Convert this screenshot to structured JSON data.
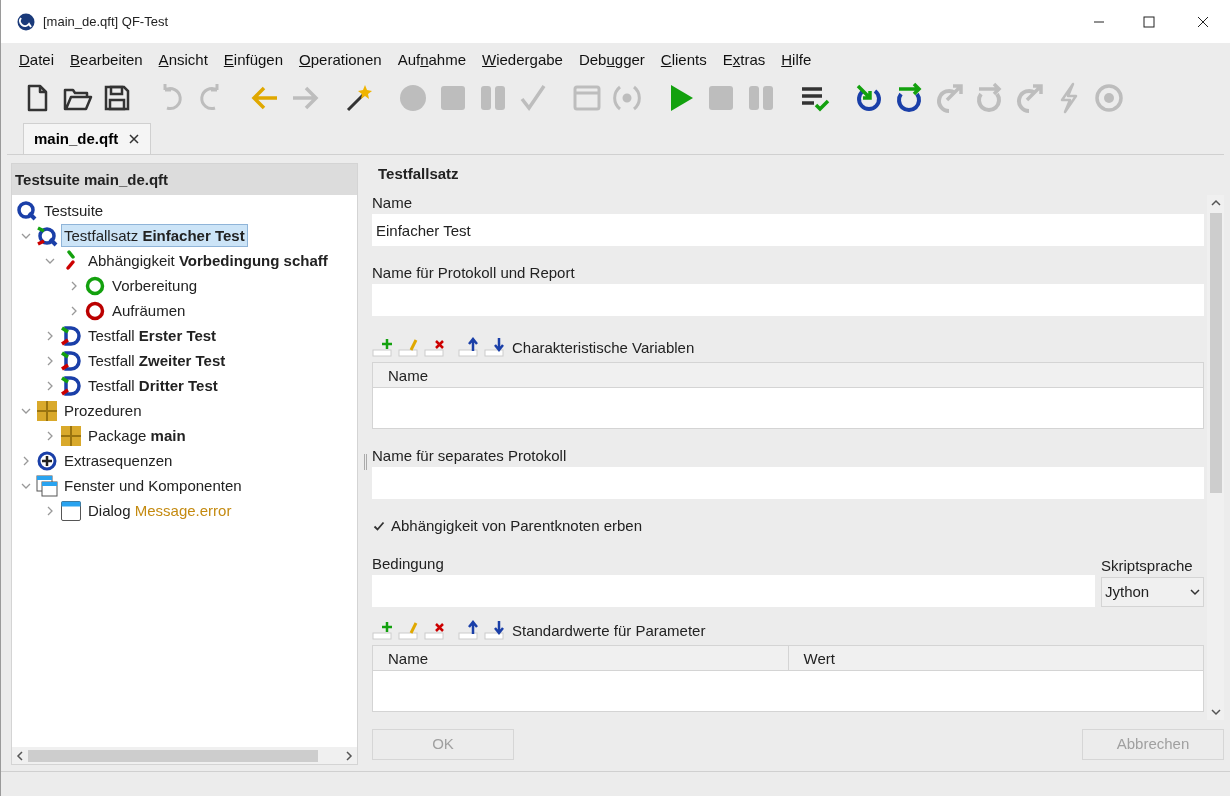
{
  "window": {
    "title": "[main_de.qft] QF-Test"
  },
  "menu": [
    {
      "key": "D",
      "post": "atei"
    },
    {
      "key": "B",
      "post": "earbeiten"
    },
    {
      "key": "A",
      "post": "nsicht"
    },
    {
      "key": "E",
      "post": "infügen"
    },
    {
      "key": "O",
      "post": "perationen"
    },
    {
      "pre": "Auf",
      "key": "n",
      "post": "ahme"
    },
    {
      "key": "W",
      "post": "iedergabe"
    },
    {
      "pre": "Deb",
      "key": "u",
      "post": "gger"
    },
    {
      "key": "C",
      "post": "lients"
    },
    {
      "pre": "E",
      "key": "x",
      "post": "tras"
    },
    {
      "key": "H",
      "post": "ilfe"
    }
  ],
  "toolbar": [
    [
      {
        "kind": "new",
        "disabled": false
      },
      {
        "kind": "open",
        "disabled": false
      },
      {
        "kind": "save",
        "disabled": false
      }
    ],
    [
      {
        "kind": "undo",
        "disabled": true
      },
      {
        "kind": "redo",
        "disabled": true
      }
    ],
    [
      {
        "kind": "back",
        "disabled": false
      },
      {
        "kind": "forward",
        "disabled": true
      }
    ],
    [
      {
        "kind": "wand",
        "disabled": false
      }
    ],
    [
      {
        "kind": "record",
        "disabled": true
      },
      {
        "kind": "stop",
        "disabled": true
      },
      {
        "kind": "pause",
        "disabled": true
      },
      {
        "kind": "check",
        "disabled": true
      }
    ],
    [
      {
        "kind": "window",
        "disabled": true
      },
      {
        "kind": "signal",
        "disabled": true
      }
    ],
    [
      {
        "kind": "play",
        "disabled": false
      },
      {
        "kind": "stop",
        "disabled": true
      },
      {
        "kind": "pause",
        "disabled": true
      }
    ],
    [
      {
        "kind": "list-check",
        "disabled": false
      }
    ],
    [
      {
        "kind": "step-in",
        "disabled": false
      },
      {
        "kind": "step-over",
        "disabled": false
      },
      {
        "kind": "step-out",
        "disabled": true
      },
      {
        "kind": "step-over",
        "disabled": true
      },
      {
        "kind": "step-out",
        "disabled": true
      },
      {
        "kind": "lightning",
        "disabled": true
      },
      {
        "kind": "target",
        "disabled": true
      }
    ]
  ],
  "tabs": [
    {
      "label": "main_de.qft",
      "selected": true
    }
  ],
  "tree": {
    "title": "Testsuite main_de.qft",
    "root": {
      "kind": "suite",
      "label": "Testsuite",
      "selected": false,
      "children": [
        {
          "kind": "testset",
          "label": "Testfallsatz **Einfacher Test**",
          "selected": true,
          "expanded": true,
          "children": [
            {
              "kind": "dependency",
              "label": "Abhängigkeit **Vorbedingung schaff**",
              "selected": false,
              "expanded": true,
              "children": [
                {
                  "kind": "setup",
                  "label": "Vorbereitung",
                  "selected": false,
                  "expanded": false
                },
                {
                  "kind": "cleanup",
                  "label": "Aufräumen",
                  "selected": false,
                  "expanded": false
                }
              ]
            },
            {
              "kind": "testcase",
              "label": "Testfall **Erster Test**",
              "selected": false,
              "expanded": false
            },
            {
              "kind": "testcase",
              "label": "Testfall **Zweiter Test**",
              "selected": false,
              "expanded": false
            },
            {
              "kind": "testcase",
              "label": "Testfall **Dritter Test**",
              "selected": false,
              "expanded": false
            }
          ]
        },
        {
          "kind": "procedures",
          "label": "Prozeduren",
          "selected": false,
          "expanded": true,
          "children": [
            {
              "kind": "package",
              "label": "Package **main**",
              "selected": false,
              "expanded": false
            }
          ]
        },
        {
          "kind": "extras",
          "label": "Extrasequenzen",
          "selected": false,
          "expanded": false
        },
        {
          "kind": "windows",
          "label": "Fenster und Komponenten",
          "selected": false,
          "expanded": true,
          "children": [
            {
              "kind": "dialog",
              "label": "Dialog",
              "ref": "Message.error",
              "selected": false,
              "expanded": false
            }
          ]
        }
      ]
    }
  },
  "detail": {
    "title": "Testfallsatz",
    "name": {
      "label": "Name",
      "value": "Einfacher Test"
    },
    "report_name": {
      "label": "Name für Protokoll und Report"
    },
    "variables": {
      "label": "Charakteristische Variablen",
      "columns": [
        "Name"
      ]
    },
    "separate_log": {
      "label": "Name für separates Protokoll"
    },
    "inherit": {
      "label": "Abhängigkeit von Parentknoten erben",
      "checked": true
    },
    "condition": {
      "label": "Bedingung"
    },
    "script_language": {
      "label": "Skriptsprache",
      "value": "Jython"
    },
    "defaults": {
      "label": "Standardwerte für Parameter",
      "columns": [
        "Name",
        "Wert"
      ]
    },
    "buttons": [
      {
        "label": "OK",
        "disabled": true
      },
      {
        "label": "Abbrechen",
        "disabled": true
      }
    ]
  }
}
